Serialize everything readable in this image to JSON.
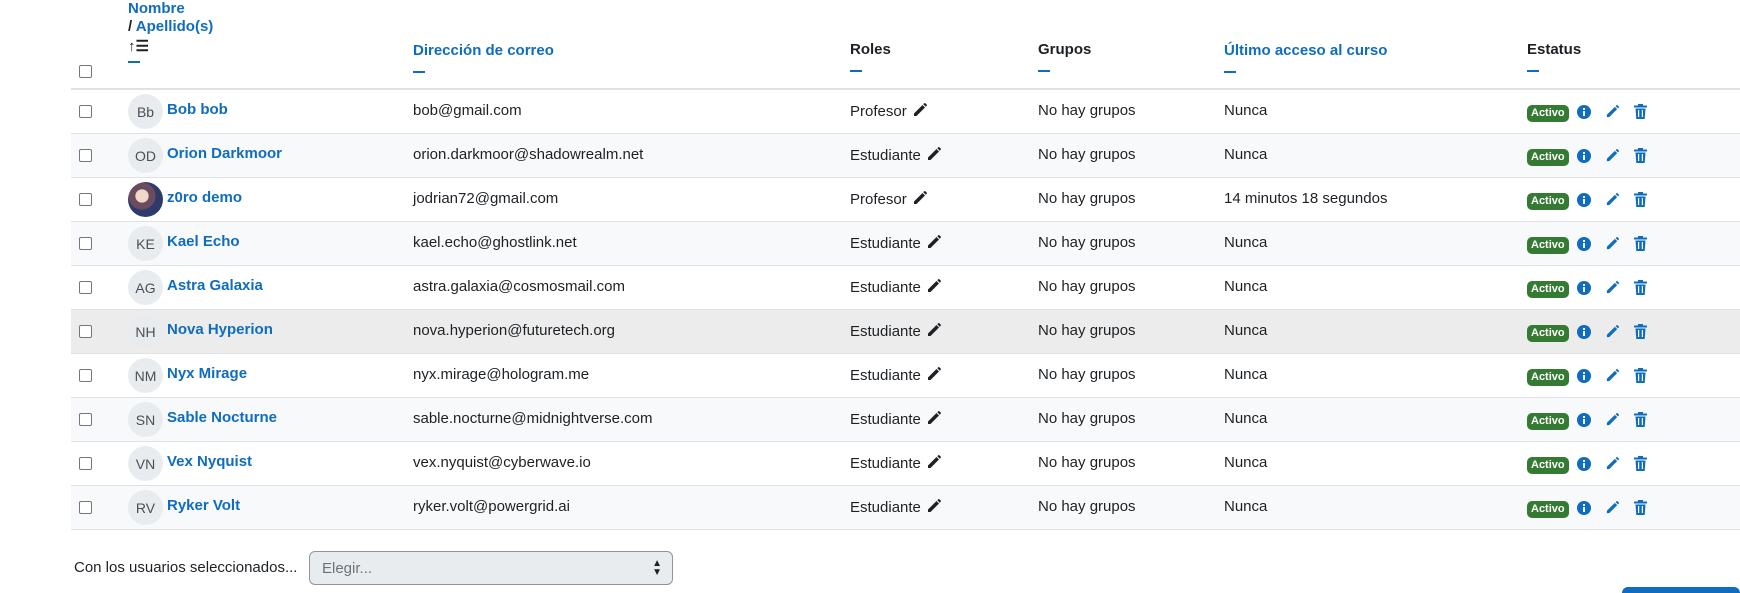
{
  "headers": {
    "name_line1": "Nombre",
    "name_slash": "/",
    "name_line2": "Apellido(s)",
    "email": "Dirección de correo",
    "roles": "Roles",
    "groups": "Grupos",
    "last_access": "Último acceso al curso",
    "status": "Estatus"
  },
  "rows": [
    {
      "initials": "Bb",
      "name": "Bob bob",
      "email": "bob@gmail.com",
      "role": "Profesor",
      "groups": "No hay grupos",
      "access": "Nunca",
      "status": "Activo"
    },
    {
      "initials": "OD",
      "name": "Orion Darkmoor",
      "email": "orion.darkmoor@shadowrealm.net",
      "role": "Estudiante",
      "groups": "No hay grupos",
      "access": "Nunca",
      "status": "Activo"
    },
    {
      "initials": "",
      "name": "z0ro demo",
      "email": "jodrian72@gmail.com",
      "role": "Profesor",
      "groups": "No hay grupos",
      "access": "14 minutos 18 segundos",
      "status": "Activo"
    },
    {
      "initials": "KE",
      "name": "Kael Echo",
      "email": "kael.echo@ghostlink.net",
      "role": "Estudiante",
      "groups": "No hay grupos",
      "access": "Nunca",
      "status": "Activo"
    },
    {
      "initials": "AG",
      "name": "Astra Galaxia",
      "email": "astra.galaxia@cosmosmail.com",
      "role": "Estudiante",
      "groups": "No hay grupos",
      "access": "Nunca",
      "status": "Activo"
    },
    {
      "initials": "NH",
      "name": "Nova Hyperion",
      "email": "nova.hyperion@futuretech.org",
      "role": "Estudiante",
      "groups": "No hay grupos",
      "access": "Nunca",
      "status": "Activo"
    },
    {
      "initials": "NM",
      "name": "Nyx Mirage",
      "email": "nyx.mirage@hologram.me",
      "role": "Estudiante",
      "groups": "No hay grupos",
      "access": "Nunca",
      "status": "Activo"
    },
    {
      "initials": "SN",
      "name": "Sable Nocturne",
      "email": "sable.nocturne@midnightverse.com",
      "role": "Estudiante",
      "groups": "No hay grupos",
      "access": "Nunca",
      "status": "Activo"
    },
    {
      "initials": "VN",
      "name": "Vex Nyquist",
      "email": "vex.nyquist@cyberwave.io",
      "role": "Estudiante",
      "groups": "No hay grupos",
      "access": "Nunca",
      "status": "Activo"
    },
    {
      "initials": "RV",
      "name": "Ryker Volt",
      "email": "ryker.volt@powergrid.ai",
      "role": "Estudiante",
      "groups": "No hay grupos",
      "access": "Nunca",
      "status": "Activo"
    }
  ],
  "footer": {
    "label": "Con los usuarios seleccionados...",
    "select_value": "Elegir..."
  },
  "icons": {
    "sort": "sort-ascending-icon",
    "collapse": "minus-icon",
    "edit_role": "pencil-icon",
    "info": "info-circle-icon",
    "edit": "edit-pencil-icon",
    "delete": "trash-icon"
  },
  "colors": {
    "link": "#0f6cbf",
    "status_badge": "#357a32",
    "row_stripe": "#f8f9fa",
    "row_hover": "#ececec"
  }
}
